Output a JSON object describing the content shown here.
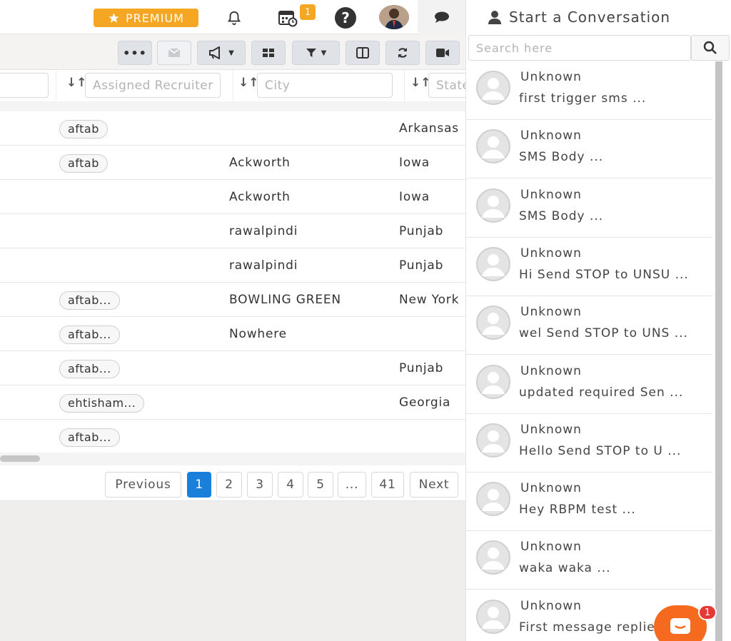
{
  "navbar": {
    "premium_label": "PREMIUM",
    "calendar_badge": "1",
    "icons": [
      "bell-icon",
      "calendar-icon",
      "help-icon",
      "chat-bubble-icon"
    ],
    "accent_color": "#f5a623"
  },
  "toolbar": {
    "buttons": [
      "more-icon",
      "envelope-icon",
      "megaphone-icon",
      "grid-icon",
      "filter-icon",
      "columns-icon",
      "refresh-icon",
      "video-icon"
    ]
  },
  "filters": {
    "assigned_placeholder": "Assigned Recruiter",
    "city_placeholder": "City",
    "state_placeholder": "State"
  },
  "table": {
    "rows": [
      {
        "recruiter": "aftab",
        "city": "",
        "state": "Arkansas"
      },
      {
        "recruiter": "aftab",
        "city": "Ackworth",
        "state": "Iowa"
      },
      {
        "recruiter": "",
        "city": "Ackworth",
        "state": "Iowa"
      },
      {
        "recruiter": "",
        "city": "rawalpindi",
        "state": "Punjab"
      },
      {
        "recruiter": "",
        "city": "rawalpindi",
        "state": "Punjab"
      },
      {
        "recruiter": "aftab...",
        "city": "BOWLING GREEN",
        "state": "New York"
      },
      {
        "recruiter": "aftab...",
        "city": "Nowhere",
        "state": ""
      },
      {
        "recruiter": "aftab...",
        "city": "",
        "state": "Punjab"
      },
      {
        "recruiter": "ehtisham...",
        "city": "",
        "state": "Georgia"
      },
      {
        "recruiter": "aftab...",
        "city": "",
        "state": ""
      }
    ]
  },
  "pagination": {
    "previous": "Previous",
    "pages": [
      "1",
      "2",
      "3",
      "4",
      "5",
      "...",
      "41"
    ],
    "active_page": "1",
    "next": "Next",
    "active_color": "#1a7fdb"
  },
  "chat": {
    "title": "Start a Conversation",
    "search_placeholder": "Search here",
    "conversations": [
      {
        "name": "Unknown",
        "message": "first trigger sms ..."
      },
      {
        "name": "Unknown",
        "message": "SMS Body ..."
      },
      {
        "name": "Unknown",
        "message": "SMS Body ..."
      },
      {
        "name": "Unknown",
        "message": "Hi Send STOP to UNSU ..."
      },
      {
        "name": "Unknown",
        "message": "wel Send STOP to UNS ..."
      },
      {
        "name": "Unknown",
        "message": "updated required Sen ..."
      },
      {
        "name": "Unknown",
        "message": "Hello Send STOP to U ..."
      },
      {
        "name": "Unknown",
        "message": "Hey RBPM test ..."
      },
      {
        "name": "Unknown",
        "message": "waka waka ..."
      },
      {
        "name": "Unknown",
        "message": "First message replie"
      }
    ],
    "launcher_badge": "1",
    "launcher_color": "#f56a1e"
  }
}
